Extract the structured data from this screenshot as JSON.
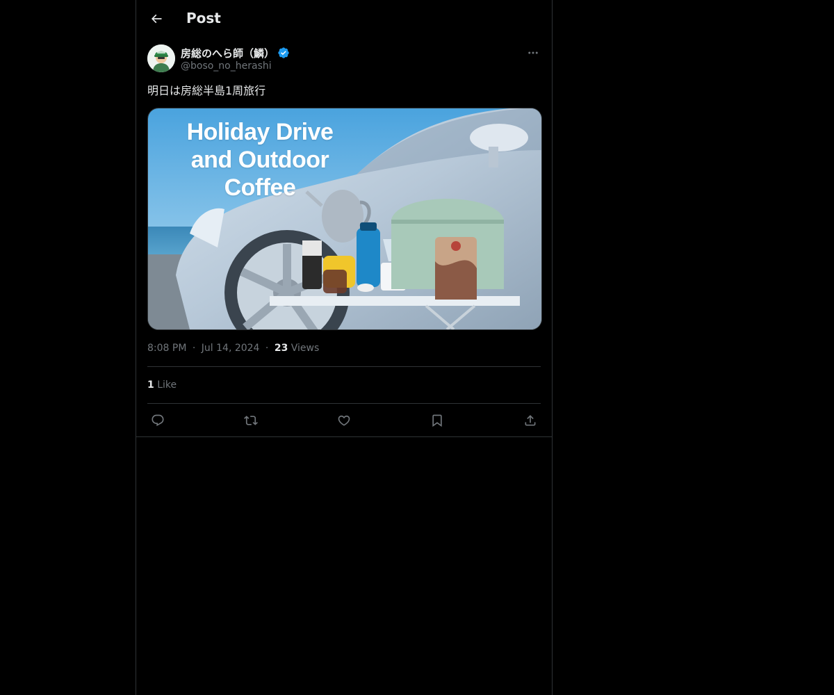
{
  "header": {
    "title": "Post",
    "back_icon": "arrow-left-icon"
  },
  "author": {
    "display_name": "房総のへら師（鱗）",
    "handle": "@boso_no_herashi",
    "verified": true,
    "verified_color": "#1d9bf0"
  },
  "tweet": {
    "text": "明日は房総半島1周旅行",
    "media": {
      "title_line1": "Holiday Drive",
      "title_line2": "and Outdoor Coffee"
    },
    "time": "8:08 PM",
    "date": "Jul 14, 2024",
    "separator": "·",
    "views_count": "23",
    "views_label": "Views",
    "likes_count": "1",
    "likes_label": "Like"
  },
  "actions": [
    {
      "name": "reply",
      "icon": "reply-icon"
    },
    {
      "name": "repost",
      "icon": "repost-icon"
    },
    {
      "name": "like",
      "icon": "heart-icon"
    },
    {
      "name": "bookmark",
      "icon": "bookmark-icon"
    },
    {
      "name": "share",
      "icon": "share-icon"
    }
  ],
  "colors": {
    "background": "#000000",
    "text_primary": "#e7e9ea",
    "text_secondary": "#71767b",
    "border": "#2f3336"
  }
}
